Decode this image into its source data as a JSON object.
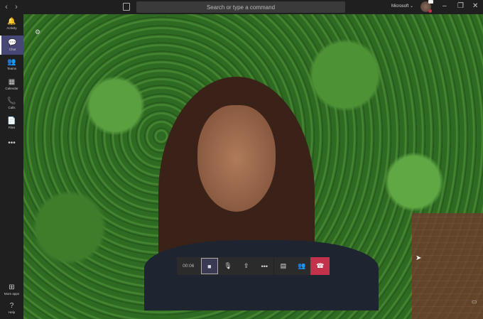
{
  "titlebar": {
    "back_icon": "‹",
    "forward_icon": "›",
    "search_placeholder": "Search or type a command",
    "org": "Microsoft ⌄",
    "minimize": "–",
    "maximize": "❐",
    "close": "✕"
  },
  "rail": {
    "items": [
      {
        "label": "Activity",
        "icon": "🔔"
      },
      {
        "label": "Chat",
        "icon": "💬"
      },
      {
        "label": "Teams",
        "icon": "👥"
      },
      {
        "label": "Calendar",
        "icon": "▦"
      },
      {
        "label": "Calls",
        "icon": "📞"
      },
      {
        "label": "Files",
        "icon": "📄"
      },
      {
        "label": "",
        "icon": "•••"
      }
    ],
    "bottom": [
      {
        "label": "More apps",
        "icon": "⊞"
      },
      {
        "label": "Help",
        "icon": "?"
      }
    ]
  },
  "call": {
    "timer": "00:06",
    "video_icon": "■",
    "mic_icon": "🎙",
    "share_icon": "⇪",
    "more_icon": "•••",
    "chat_icon": "▤",
    "participants_icon": "👥",
    "hangup_icon": "☎"
  },
  "colors": {
    "accent": "#464775",
    "hangup": "#c4314b"
  }
}
